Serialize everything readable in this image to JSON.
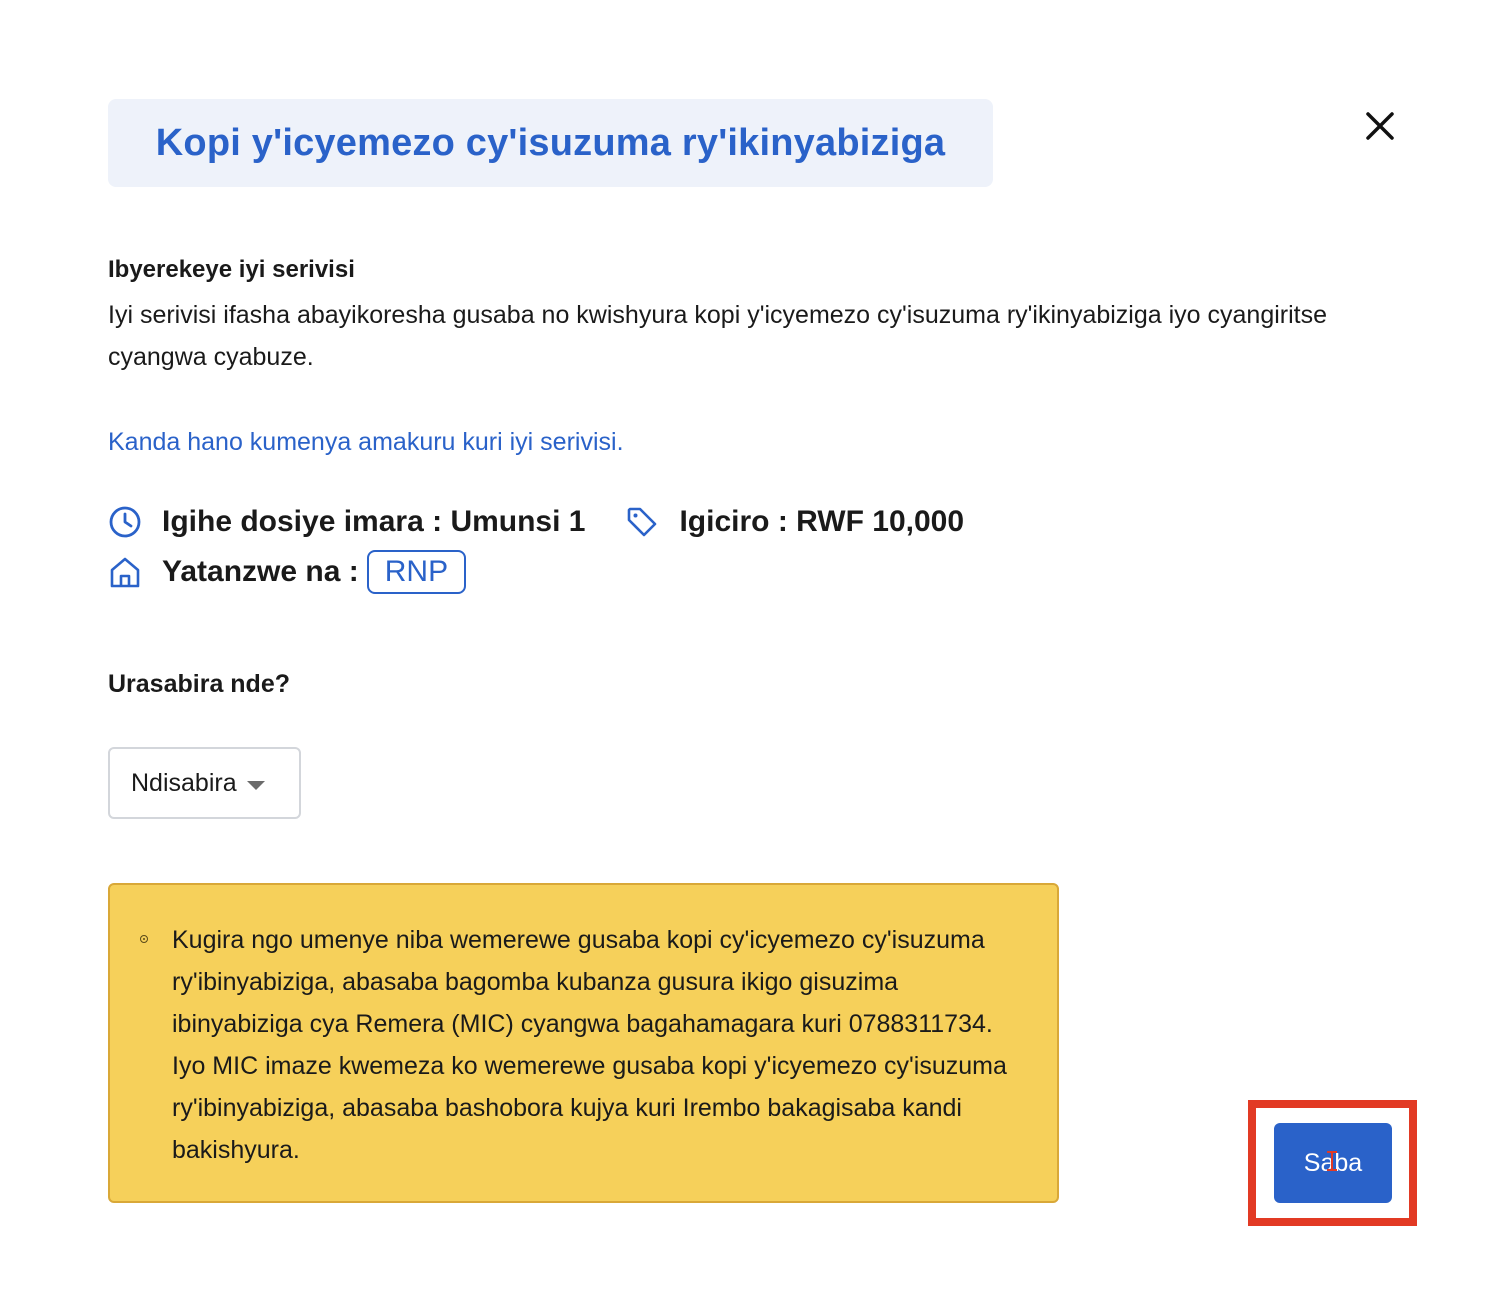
{
  "dialog": {
    "title": "Kopi y'icyemezo cy'isuzuma ry'ikinyabiziga",
    "close_icon": "close-icon"
  },
  "about": {
    "heading": "Ibyerekeye iyi serivisi",
    "text": "Iyi serivisi ifasha abayikoresha gusaba no kwishyura kopi y'icyemezo cy'isuzuma ry'ikinyabiziga iyo cyangiritse cyangwa cyabuze.",
    "link_text": "Kanda hano kumenya amakuru kuri iyi serivisi."
  },
  "meta": {
    "processing_label": "Igihe dosiye imara :",
    "processing_value": "Umunsi 1",
    "price_label": "Igiciro :",
    "price_value": "RWF 10,000",
    "provider_label": "Yatanzwe na :",
    "provider_badge": "RNP",
    "icons": [
      "clock-icon",
      "price-tag-icon",
      "building-icon"
    ]
  },
  "applicant": {
    "question": "Urasabira nde?",
    "selected": "Ndisabira"
  },
  "notice": {
    "text": "Kugira ngo umenye niba wemerewe gusaba kopi cy'icyemezo cy'isuzuma ry'ibinyabiziga, abasaba bagomba kubanza gusura ikigo gisuzima ibinyabiziga cya Remera (MIC) cyangwa bagahamagara kuri 0788311734. Iyo MIC imaze kwemeza ko wemerewe gusaba kopi y'icyemezo cy'isuzuma ry'ibinyabiziga, abasaba bashobora kujya kuri Irembo bakagisaba kandi bakishyura."
  },
  "actions": {
    "submit_label": "Saba"
  },
  "colors": {
    "accent": "#2a62c9",
    "title_bg": "#eef2fa",
    "notice_bg": "#f6d05a",
    "notice_border": "#d9a838",
    "highlight": "#e23a24"
  }
}
